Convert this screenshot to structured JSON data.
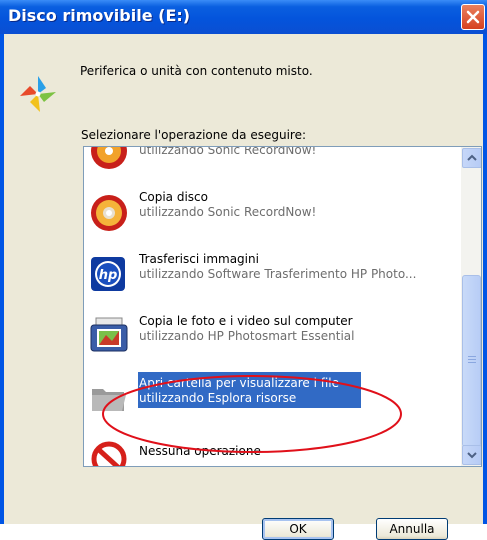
{
  "window": {
    "title": "Disco rimovibile (E:)",
    "description": "Periferica o unità con contenuto misto.",
    "prompt": "Selezionare l'operazione da eseguire:"
  },
  "list": {
    "items": [
      {
        "title": "",
        "subtitle": "utilizzando Sonic RecordNow!",
        "icon": "cd-disc-icon",
        "selected": false
      },
      {
        "title": "Copia disco",
        "subtitle": "utilizzando Sonic RecordNow!",
        "icon": "cd-disc-icon",
        "selected": false
      },
      {
        "title": "Trasferisci immagini",
        "subtitle": "utilizzando Software Trasferimento HP Photo...",
        "icon": "hp-logo-icon",
        "selected": false
      },
      {
        "title": "Copia le foto e i video sul computer",
        "subtitle": "utilizzando HP Photosmart Essential",
        "icon": "photo-printer-icon",
        "selected": false
      },
      {
        "title": "Apri cartella per visualizzare i file",
        "subtitle": "utilizzando Esplora risorse",
        "icon": "folder-icon",
        "selected": true
      },
      {
        "title": "Nessuna operazione",
        "subtitle": "",
        "icon": "no-action-icon",
        "selected": false
      }
    ]
  },
  "buttons": {
    "ok": "OK",
    "cancel": "Annulla"
  },
  "colors": {
    "titlebar": "#0454dc",
    "selection": "#316ac5",
    "annotation": "#e0101a",
    "dialog_bg": "#ece9d8"
  }
}
